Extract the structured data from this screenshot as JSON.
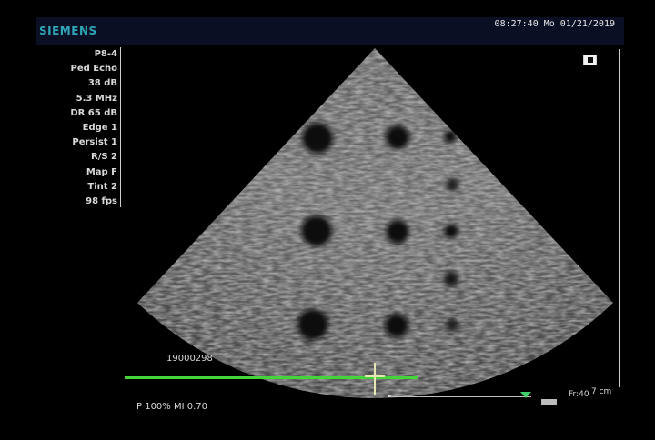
{
  "header": {
    "brand": "SIEMENS",
    "datetime": "08:27:40  Mo  01/21/2019"
  },
  "params": [
    "P8-4",
    "Ped Echo",
    "38 dB",
    "5.3 MHz",
    "DR 65 dB",
    "Edge 1",
    "Persist 1",
    "R/S 2",
    "Map F",
    "Tint 2",
    "98 fps"
  ],
  "image": {
    "id_label": "19000298",
    "fr_label": "Fr:40",
    "depth_label": "7 cm"
  },
  "footer": {
    "power_label": "P 100%   MI 0.70"
  },
  "colors": {
    "brand": "#2fa6b8",
    "green": "#45d33a",
    "header_bg": "#0b0f24"
  }
}
